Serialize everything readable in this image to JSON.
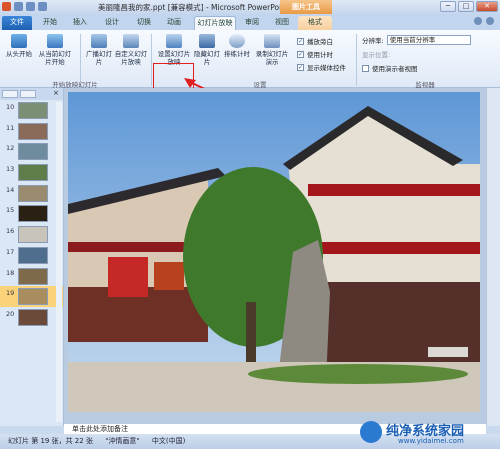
{
  "title": "美丽隆昌我的家.ppt [兼容模式] - Microsoft PowerPoint",
  "context_tab": "图片工具",
  "window_buttons": {
    "minimize": "─",
    "maximize": "□",
    "close": "✕"
  },
  "tabs": [
    "文件",
    "开始",
    "插入",
    "设计",
    "切换",
    "动画",
    "幻灯片放映",
    "审阅",
    "视图",
    "格式"
  ],
  "ribbon": {
    "groups": {
      "start": "开始放映幻灯片",
      "settings": "设置",
      "monitors": "监视器"
    },
    "from_beginning": "从头开始",
    "from_current": "从当前幻灯片开始",
    "broadcast": "广播幻灯片",
    "custom": "自定义幻灯片放映",
    "setup": "设置幻灯片放映",
    "hide": "隐藏幻灯片",
    "rehearse": "排练计时",
    "record": "录制幻灯片演示",
    "play_narration": "播放旁白",
    "use_timings": "使用计时",
    "show_media": "显示媒体控件",
    "resolution_label": "分辨率:",
    "resolution_value": "使用当前分辨率",
    "show_on_label": "显示位置:",
    "presenter_view": "使用演示者视图"
  },
  "slides": [
    "10",
    "11",
    "12",
    "13",
    "14",
    "15",
    "16",
    "17",
    "18",
    "19",
    "20"
  ],
  "current_slide": "19",
  "notes": "单击此处添加备注",
  "status": {
    "slide": "幻灯片 第 19 张，共 22 张",
    "theme": "\"沖情画意\"",
    "lang": "中文(中国)"
  },
  "watermark": {
    "brand": "纯净系统家园",
    "url": "www.yidaimei.com"
  },
  "colors": {
    "accent": "#1e5fb0",
    "highlight": "#e02020",
    "format_tab": "#f7cf9f"
  }
}
